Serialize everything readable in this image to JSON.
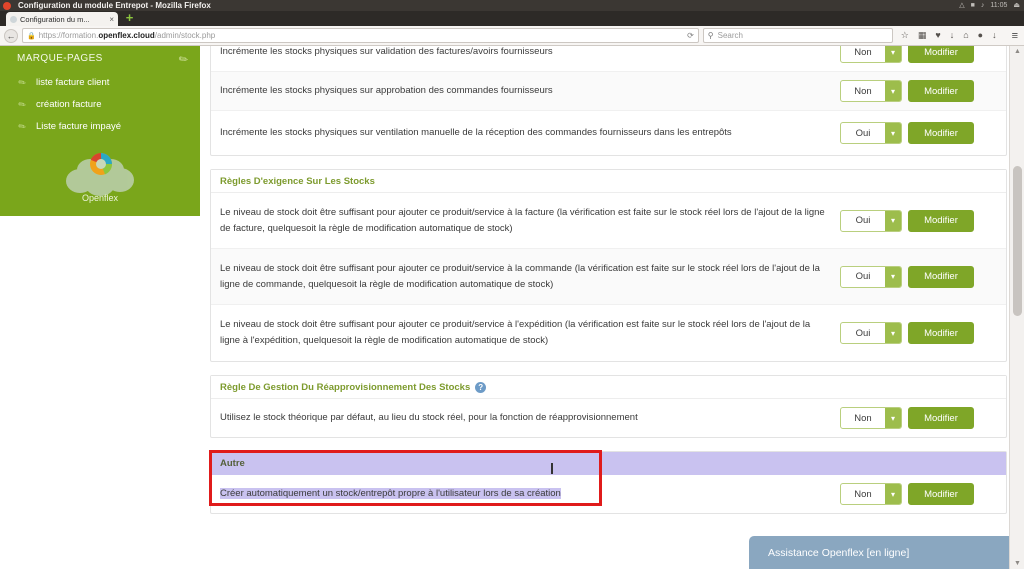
{
  "os": {
    "window_title": "Configuration du module Entrepot - Mozilla Firefox",
    "clock": "11:05",
    "tray_icons": [
      "network-icon",
      "battery-icon",
      "volume-icon",
      "power-icon"
    ]
  },
  "browser": {
    "tab": {
      "title": "Configuration du m...",
      "close_label": "×",
      "favicon": "page-favicon"
    },
    "new_tab_label": "+",
    "back_label": "←",
    "url": {
      "lock": "🔒",
      "prefix": "https://formation.",
      "host": "openflex.cloud",
      "path": "/admin/stock.php",
      "reload_label": "⟳"
    },
    "search": {
      "placeholder": "Search",
      "icon": "search-icon"
    },
    "toolbar_icons": [
      "bookmark-star-icon",
      "reader-icon",
      "pocket-icon",
      "download-icon",
      "home-icon",
      "chat-icon",
      "sync-icon"
    ],
    "menu_label": "≡"
  },
  "sidebar": {
    "heading": "MARQUE-PAGES",
    "edit_icon": "pencil-icon",
    "bookmarks": [
      {
        "label": "liste facture client",
        "icon": "bookmark-icon"
      },
      {
        "label": "création facture",
        "icon": "bookmark-icon"
      },
      {
        "label": "Liste facture impayé",
        "icon": "bookmark-icon"
      }
    ],
    "logo_label": "Openflex"
  },
  "controls": {
    "modify_label": "Modifier",
    "yes": "Oui",
    "no": "Non",
    "arrow": "⌄"
  },
  "sections": [
    {
      "id": "incrementation",
      "title": "",
      "rows": [
        {
          "label": "Incrémente les stocks physiques sur validation des factures/avoirs fournisseurs",
          "value": "Non"
        },
        {
          "label": "Incrémente les stocks physiques sur approbation des commandes fournisseurs",
          "value": "Non"
        },
        {
          "label": "Incrémente les stocks physiques sur ventilation manuelle de la réception des commandes fournisseurs dans les entrepôts",
          "value": "Oui"
        }
      ]
    },
    {
      "id": "exigence",
      "title": "Règles D'exigence Sur Les Stocks",
      "help": false,
      "rows": [
        {
          "label": "Le niveau de stock doit être suffisant pour ajouter ce produit/service à la facture (la vérification est faite sur le stock réel lors de l'ajout de la ligne de facture, quelquesoit la règle de modification automatique de stock)",
          "value": "Oui"
        },
        {
          "label": "Le niveau de stock doit être suffisant pour ajouter ce produit/service à la commande (la vérification est faite sur le stock réel lors de l'ajout de la ligne de commande, quelquesoit la règle de modification automatique de stock)",
          "value": "Oui"
        },
        {
          "label": "Le niveau de stock doit être suffisant pour ajouter ce produit/service à l'expédition (la vérification est faite sur le stock réel lors de l'ajout de la ligne à l'expédition, quelquesoit la règle de modification automatique de stock)",
          "value": "Oui"
        }
      ]
    },
    {
      "id": "reappro",
      "title": "Règle De Gestion Du Réapprovisionnement Des Stocks",
      "help": true,
      "help_label": "?",
      "rows": [
        {
          "label": "Utilisez le stock théorique par défaut, au lieu du stock réel, pour la fonction de réapprovisionnement",
          "value": "Non"
        }
      ]
    },
    {
      "id": "autre",
      "title": "Autre",
      "help": false,
      "highlighted": true,
      "rows": [
        {
          "label": "Créer automatiquement un stock/entrepôt propre à l'utilisateur lors de sa création",
          "value": "Non"
        }
      ]
    }
  ],
  "assistance": {
    "label": "Assistance Openflex [en ligne]"
  },
  "colors": {
    "brand_green": "#7aa61b",
    "button_green": "#7fa628",
    "section_title": "#7d9b2e",
    "highlight_red": "#e01b1b",
    "selection_purple": "#c9c2f0",
    "assistance_blue": "#8aa7c0"
  }
}
